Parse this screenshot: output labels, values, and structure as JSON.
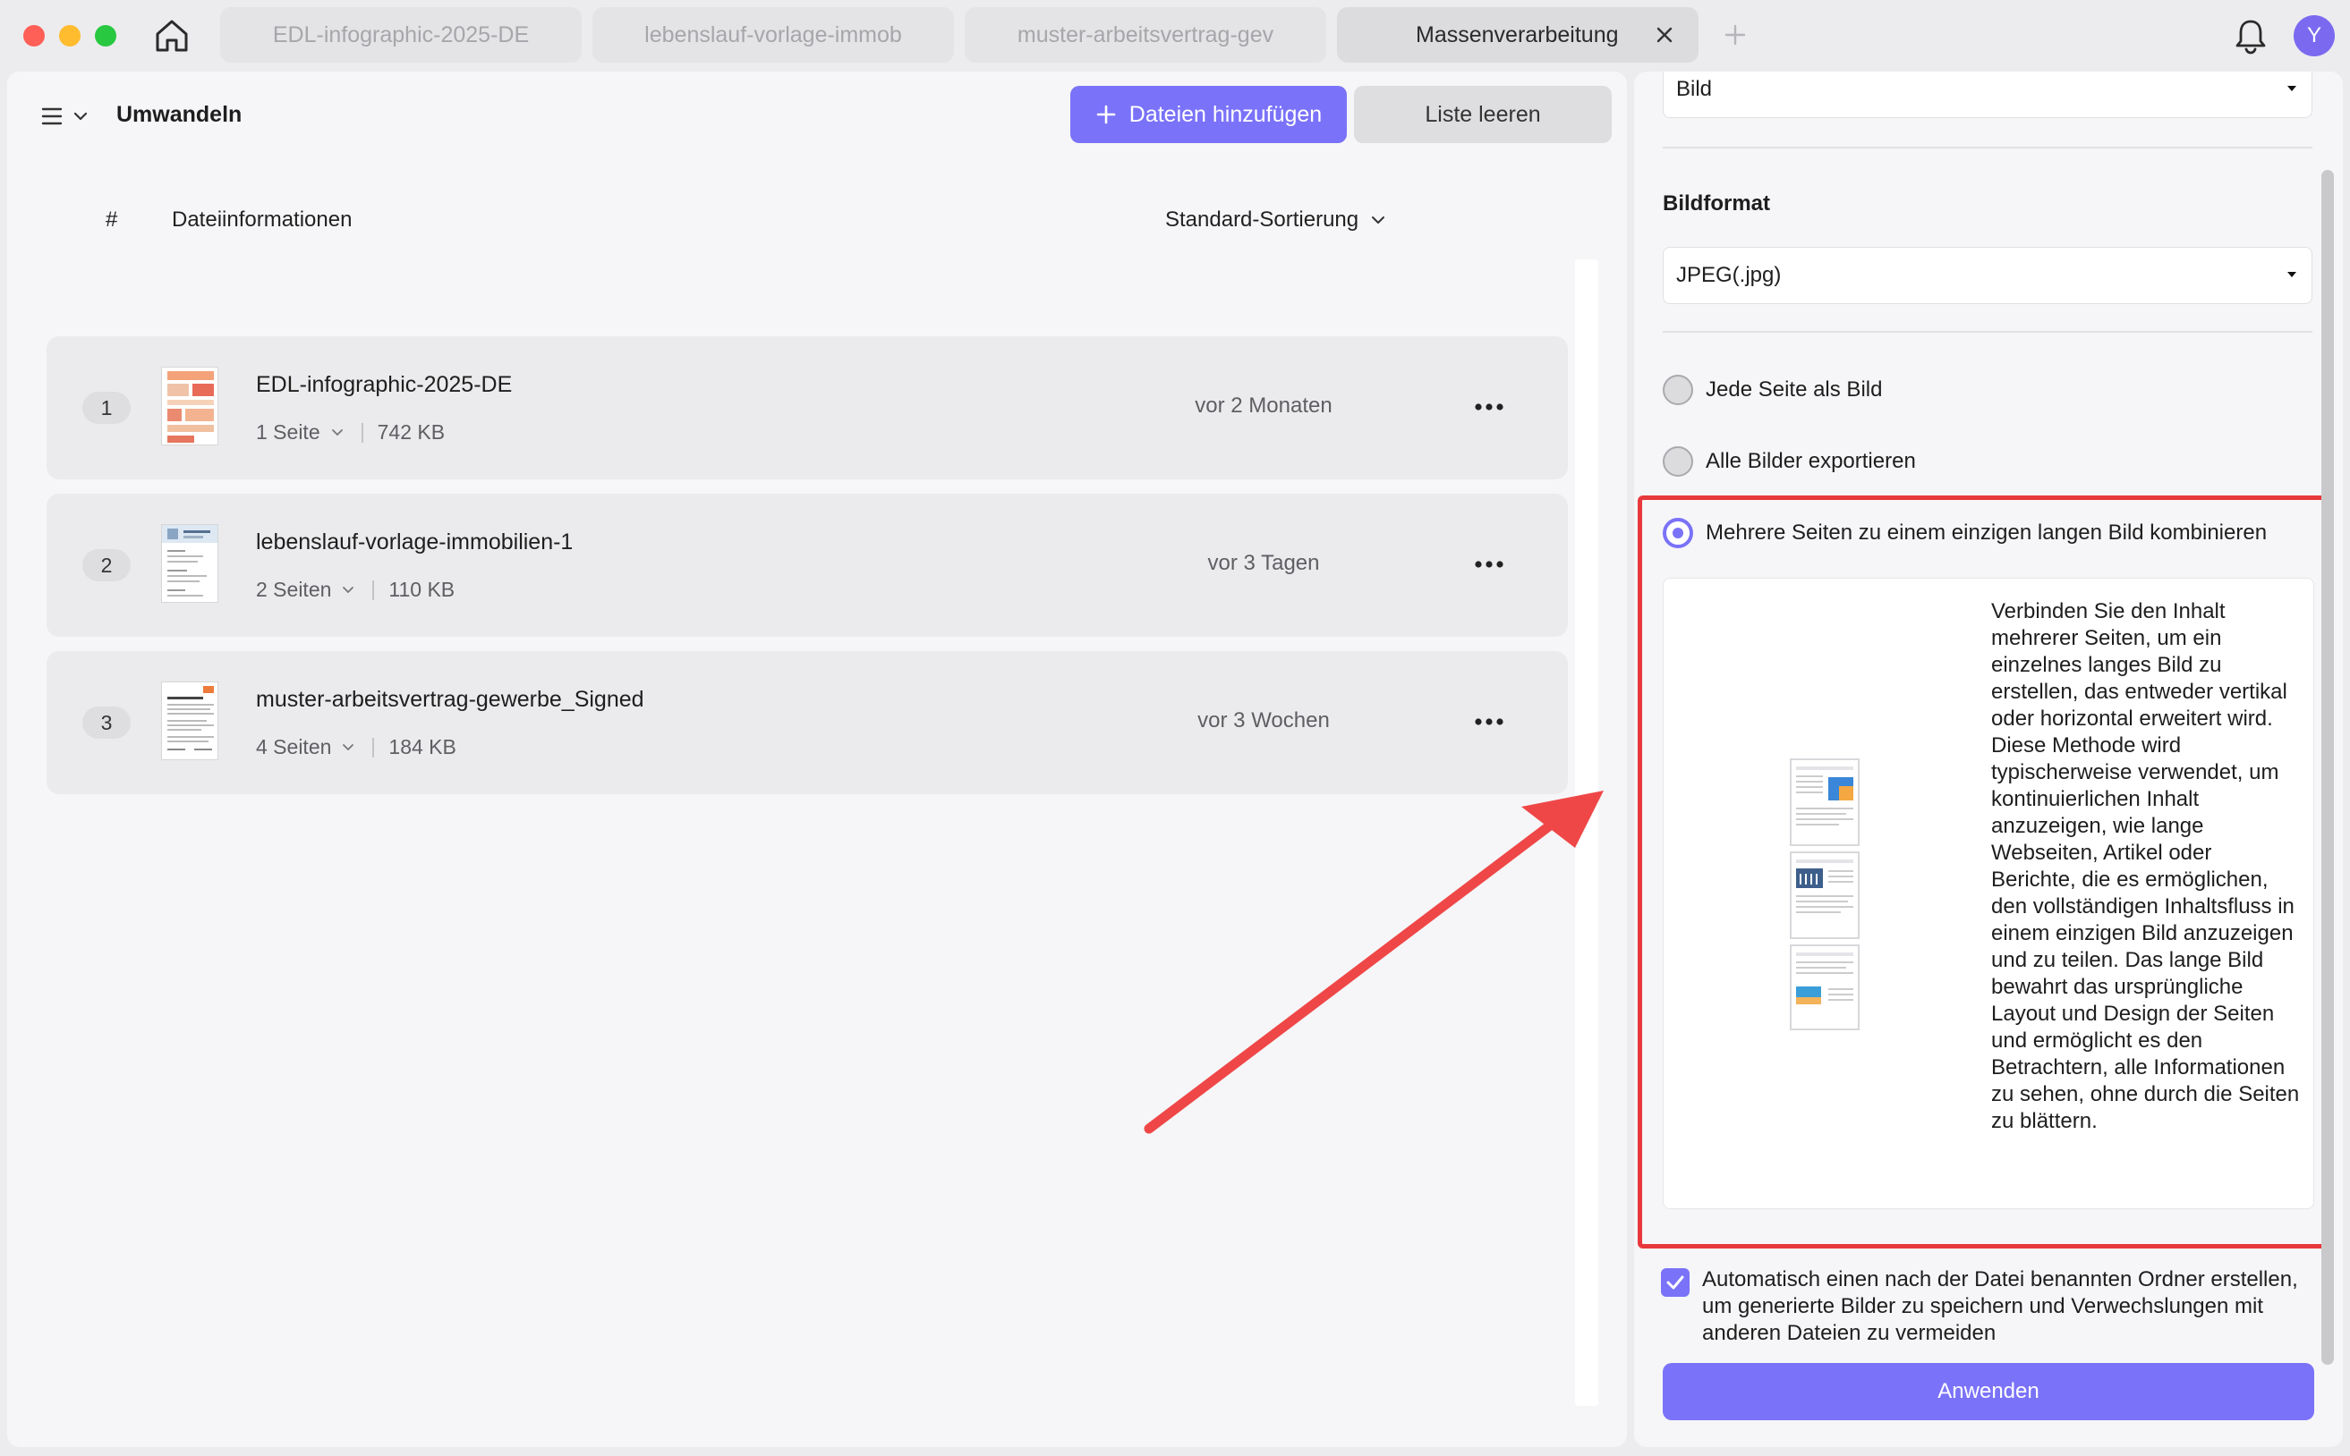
{
  "colors": {
    "accent": "#7a72f8",
    "highlight": "#e8383b",
    "avatar": "#7b6af0"
  },
  "titlebar": {
    "tabs": [
      {
        "label": "EDL-infographic-2025-DE"
      },
      {
        "label": "lebenslauf-vorlage-immob"
      },
      {
        "label": "muster-arbeitsvertrag-gev"
      },
      {
        "label": "Massenverarbeitung"
      }
    ],
    "avatar_letter": "Y"
  },
  "left": {
    "title": "Umwandeln",
    "add_button": "Dateien hinzufügen",
    "clear_button": "Liste leeren",
    "columns": {
      "number": "#",
      "info": "Dateiinformationen",
      "sort": "Standard-Sortierung"
    },
    "files": [
      {
        "index": "1",
        "name": "EDL-infographic-2025-DE",
        "pages": "1 Seite",
        "size": "742 KB",
        "date": "vor 2 Monaten"
      },
      {
        "index": "2",
        "name": "lebenslauf-vorlage-immobilien-1",
        "pages": "2 Seiten",
        "size": "110 KB",
        "date": "vor 3 Tagen"
      },
      {
        "index": "3",
        "name": "muster-arbeitsvertrag-gewerbe_Signed",
        "pages": "4 Seiten",
        "size": "184 KB",
        "date": "vor 3 Wochen"
      }
    ]
  },
  "right": {
    "output_type": "Bild",
    "format_label": "Bildformat",
    "format_value": "JPEG(.jpg)",
    "options": [
      {
        "label": "Jede Seite als Bild",
        "selected": false
      },
      {
        "label": "Alle Bilder exportieren",
        "selected": false
      },
      {
        "label": "Mehrere Seiten zu einem einzigen langen Bild kombinieren",
        "selected": true
      }
    ],
    "description": "Verbinden Sie den Inhalt mehrerer Seiten, um ein einzelnes langes Bild zu erstellen, das entweder vertikal oder horizontal erweitert wird. Diese Methode wird typischerweise verwendet, um kontinuierlichen Inhalt anzuzeigen, wie lange Webseiten, Artikel oder Berichte, die es ermöglichen, den vollständigen Inhaltsfluss in einem einzigen Bild anzuzeigen und zu teilen. Das lange Bild bewahrt das ursprüngliche Layout und Design der Seiten und ermöglicht es den Betrachtern, alle Informationen zu sehen, ohne durch die Seiten zu blättern.",
    "auto_folder": "Automatisch einen nach der Datei benannten Ordner erstellen, um generierte Bilder zu speichern und Verwechslungen mit anderen Dateien zu vermeiden",
    "auto_folder_checked": true,
    "apply_button": "Anwenden"
  }
}
